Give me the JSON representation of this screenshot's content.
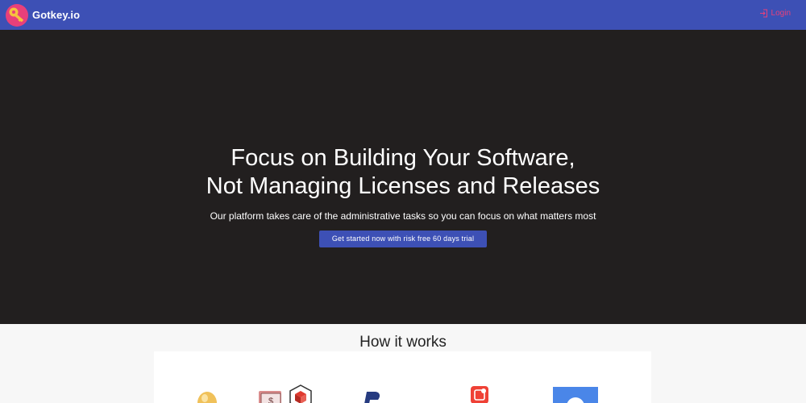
{
  "header": {
    "brand": "Gotkey.io",
    "login_label": "Login",
    "accent": "#e8407a",
    "bar_color": "#3d50b5"
  },
  "hero": {
    "title_line1": "Focus on Building Your Software,",
    "title_line2": "Not Managing Licenses and Releases",
    "subtitle": "Our platform takes care of the administrative tasks so you can focus on what matters most",
    "cta_label": "Get started now with risk free 60 days trial",
    "background": "#221f1f"
  },
  "how_it_works": {
    "heading": "How it works",
    "illustrations": [
      "golden-egg-icon",
      "money-stack-icon",
      "package-box-icon",
      "paypal-icon",
      "app-notification-icon",
      "chat-bubble-icon"
    ]
  }
}
